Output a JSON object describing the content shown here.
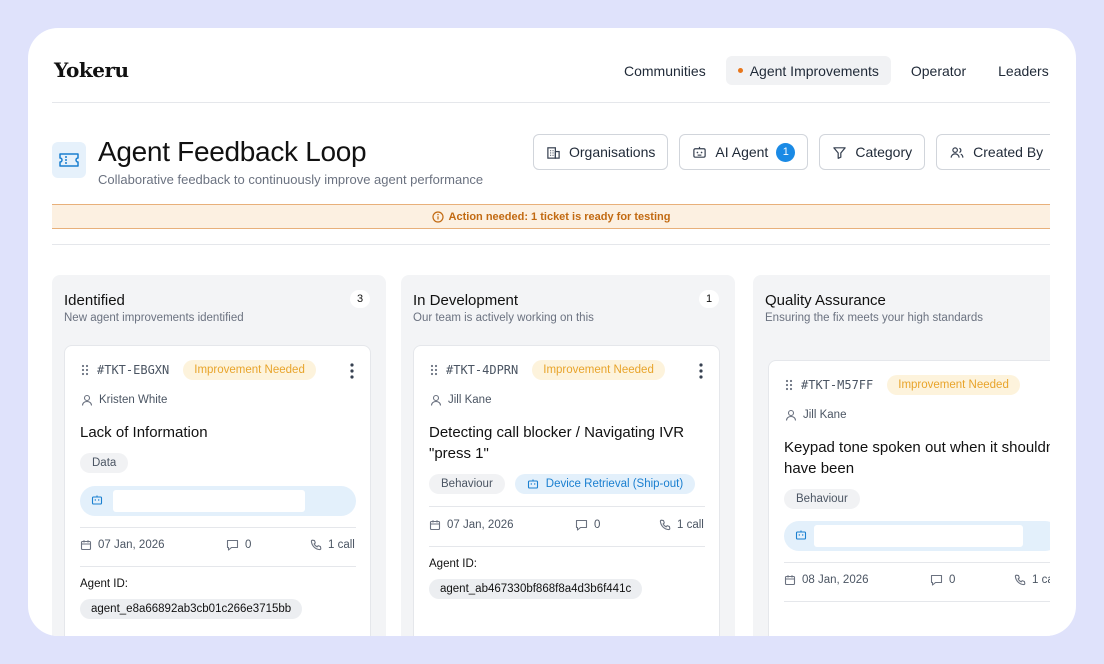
{
  "app": {
    "logo": "Yokeru"
  },
  "nav": [
    {
      "label": "Communities",
      "active": false
    },
    {
      "label": "Agent Improvements",
      "active": true
    },
    {
      "label": "Operator",
      "active": false
    },
    {
      "label": "Leaders",
      "active": false
    }
  ],
  "header": {
    "title": "Agent Feedback Loop",
    "subtitle": "Collaborative feedback to continuously improve agent performance"
  },
  "filters": {
    "organisations": "Organisations",
    "ai_agent": "AI Agent",
    "ai_agent_count": "1",
    "category": "Category",
    "created_by": "Created By"
  },
  "alert": {
    "text": "Action needed: 1 ticket is ready for testing"
  },
  "colors": {
    "accent": "#1a8ae5",
    "status": "#e8a42b",
    "alert": "#c26a12",
    "nav_dot": "#e8761b"
  },
  "columns": [
    {
      "title": "Identified",
      "subtitle": "New agent improvements identified",
      "count": "3",
      "card": {
        "ticket": "#TKT-EBGXN",
        "status": "Improvement Needed",
        "assignee": "Kristen White",
        "title": "Lack of Information",
        "tags": [
          "Data"
        ],
        "date": "07 Jan, 2026",
        "comments": "0",
        "calls": "1 call",
        "agent_id_label": "Agent ID:",
        "agent_id": "agent_e8a66892ab3cb01c266e3715bb"
      }
    },
    {
      "title": "In Development",
      "subtitle": "Our team is actively working on this",
      "count": "1",
      "card": {
        "ticket": "#TKT-4DPRN",
        "status": "Improvement Needed",
        "assignee": "Jill Kane",
        "title": "Detecting call blocker / Navigating IVR \"press 1\"",
        "tags": [
          "Behaviour"
        ],
        "agent_tag": "Device Retrieval (Ship-out)",
        "date": "07 Jan, 2026",
        "comments": "0",
        "calls": "1 call",
        "agent_id_label": "Agent ID:",
        "agent_id": "agent_ab467330bf868f8a4d3b6f441c"
      }
    },
    {
      "title": "Quality Assurance",
      "subtitle": "Ensuring the fix meets your high standards",
      "card": {
        "ticket": "#TKT-M57FF",
        "status": "Improvement Needed",
        "assignee": "Jill Kane",
        "title": "Keypad tone spoken out when it shouldn't have been",
        "tags": [
          "Behaviour"
        ],
        "date": "08 Jan, 2026",
        "comments": "0",
        "calls": "1 ca"
      }
    }
  ]
}
